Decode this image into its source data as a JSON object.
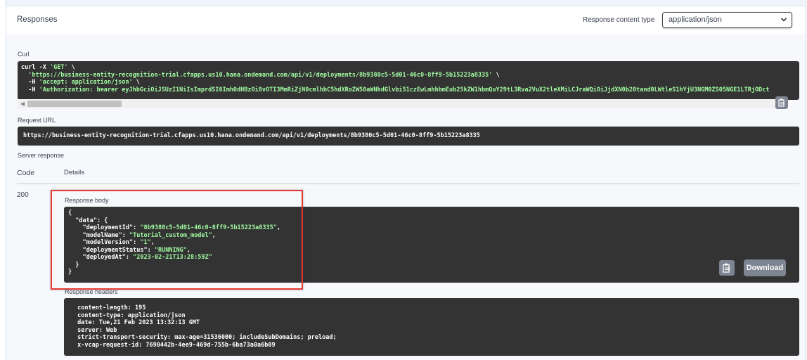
{
  "responses": {
    "title": "Responses",
    "content_type_label": "Response content type",
    "content_type_value": "application/json"
  },
  "curl": {
    "label": "Curl",
    "line1_cmd": "curl -X ",
    "line1_method": "'GET'",
    "line1_tail": " \\",
    "line2": "  'https://business-entity-recognition-trial.cfapps.us10.hana.ondemand.com/api/v1/deployments/8b9380c5-5d01-46c0-8ff9-5b15223a8335'",
    "line2_tail": " \\",
    "line3_cmd": "  -H ",
    "line3_str": "'accept: application/json'",
    "line3_tail": " \\",
    "line4_cmd": "  -H ",
    "line4_str": "'Authorization: bearer eyJhbGciOiJSUzI1NiIsImprdSI6Imh0dHBzOi8vOTI3MmRiZjN0cmlhbC5hdXRoZW50aWNhdGlvbi51czEwLmhhbmEub25kZW1hbmQuY29tL3Rva2VuX2tleXMiLCJraWQiOiJjdXN0b20tand0LWtleS1hYjU3NGM0ZS05NGE1LTRjODct"
  },
  "request_url": {
    "label": "Request URL",
    "value": "https://business-entity-recognition-trial.cfapps.us10.hana.ondemand.com/api/v1/deployments/8b9380c5-5d01-46c0-8ff9-5b15223a8335"
  },
  "server_response": {
    "label": "Server response",
    "code_header": "Code",
    "details_header": "Details",
    "code": "200"
  },
  "response_body": {
    "label": "Response body",
    "lines": [
      {
        "pre": "{",
        "key": "",
        "mid": "",
        "val": "",
        "post": ""
      },
      {
        "pre": "  \"data\": {",
        "key": "",
        "mid": "",
        "val": "",
        "post": ""
      },
      {
        "pre": "    ",
        "key": "\"deploymentId\"",
        "mid": ": ",
        "val": "\"8b9380c5-5d01-46c0-8ff9-5b15223a8335\"",
        "post": ","
      },
      {
        "pre": "    ",
        "key": "\"modelName\"",
        "mid": ": ",
        "val": "\"Tutorial_custom_model\"",
        "post": ","
      },
      {
        "pre": "    ",
        "key": "\"modelVersion\"",
        "mid": ": ",
        "val": "\"1\"",
        "post": ","
      },
      {
        "pre": "    ",
        "key": "\"deploymentStatus\"",
        "mid": ": ",
        "val": "\"RUNNING\"",
        "post": ","
      },
      {
        "pre": "    ",
        "key": "\"deployedAt\"",
        "mid": ": ",
        "val": "\"2023-02-21T13:28:59Z\"",
        "post": ""
      },
      {
        "pre": "  }",
        "key": "",
        "mid": "",
        "val": "",
        "post": ""
      },
      {
        "pre": "}",
        "key": "",
        "mid": "",
        "val": "",
        "post": ""
      }
    ],
    "download_label": "Download"
  },
  "response_headers": {
    "label": "Response headers",
    "lines": [
      " content-length: 195 ",
      " content-type: application/json ",
      " date: Tue,21 Feb 2023 13:32:13 GMT ",
      " server: Web ",
      " strict-transport-security: max-age=31536000; includeSubDomains; preload; ",
      " x-vcap-request-id: 7690442b-4ee9-469d-755b-6ba73a0a6b09 "
    ]
  },
  "icons": {
    "select_chevron": "chevron-down-icon",
    "copy": "clipboard-copy-icon",
    "scroll_left": "scroll-left-arrow-icon"
  }
}
